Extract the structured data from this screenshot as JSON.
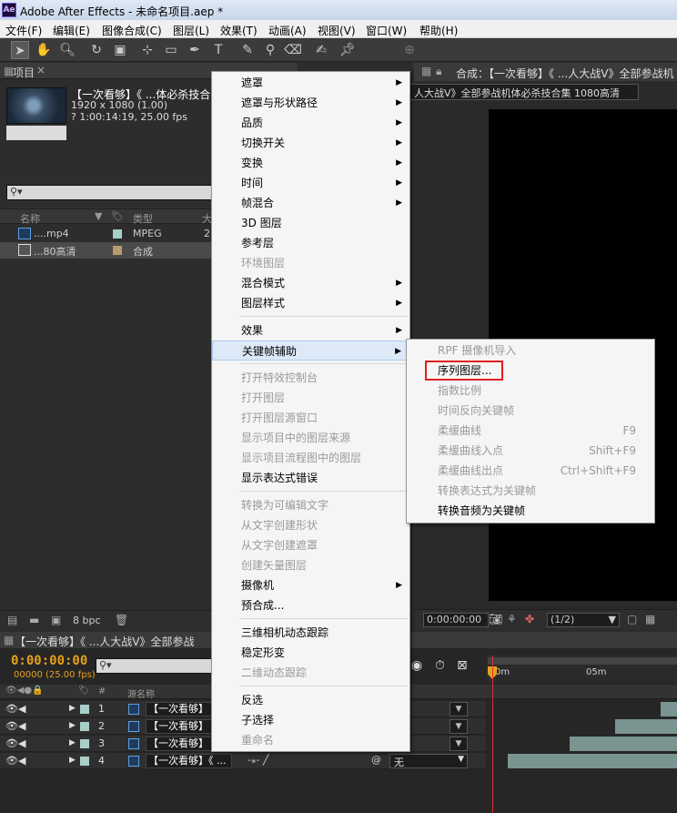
{
  "window": {
    "title": "Adobe After Effects - 未命名项目.aep *",
    "app_icon_text": "Ae"
  },
  "menubar": [
    "文件(F)",
    "编辑(E)",
    "图像合成(C)",
    "图层(L)",
    "效果(T)",
    "动画(A)",
    "视图(V)",
    "窗口(W)",
    "帮助(H)"
  ],
  "project": {
    "tab_label": "项目",
    "selected_name": "【一次看够】《 ...体必杀技合",
    "dimensions": "1920 x 1080 (1.00)",
    "duration": "? 1:00:14:19, 25.00 fps",
    "search_placeholder": "",
    "columns": {
      "name": "名称",
      "type": "类型",
      "size": "大"
    },
    "items": [
      {
        "name": "....mp4",
        "type": "MPEG",
        "extra": "2",
        "color": "#a9cfc9"
      },
      {
        "name": "...80高清",
        "type": "合成",
        "extra": "",
        "color": "#b59b6d"
      }
    ],
    "bpc": "8 bpc"
  },
  "composition": {
    "tab_label": "合成：【一次看够】《 ...人大战V》全部参战机",
    "breadcrumb": "人大战V》全部参战机体必杀技合集 1080高清",
    "timecode": "0:00:00:00",
    "resolution": "(1/2)"
  },
  "timeline": {
    "tab_label": "【一次看够】《 ...人大战V》全部参战",
    "timecode": "0:00:00:00",
    "fps_label": "00000 (25.00 fps)",
    "layer_column": "源名称",
    "num_column": "#",
    "ruler_labels": [
      "0m",
      "05m"
    ],
    "layers": [
      {
        "num": "1",
        "name": "【一次看够】"
      },
      {
        "num": "2",
        "name": "【一次看够】"
      },
      {
        "num": "3",
        "name": "【一次看够】"
      },
      {
        "num": "4",
        "name": "【一次看够】《 ..."
      }
    ],
    "parent_value": "无"
  },
  "context_menu": {
    "items": [
      {
        "label": "遮罩",
        "submenu": true,
        "disabled": false
      },
      {
        "label": "遮罩与形状路径",
        "submenu": true,
        "disabled": false
      },
      {
        "label": "品质",
        "submenu": true,
        "disabled": false
      },
      {
        "label": "切换开关",
        "submenu": true,
        "disabled": false
      },
      {
        "label": "变换",
        "submenu": true,
        "disabled": false
      },
      {
        "label": "时间",
        "submenu": true,
        "disabled": false
      },
      {
        "label": "帧混合",
        "submenu": true,
        "disabled": false
      },
      {
        "label": "3D 图层",
        "submenu": false,
        "disabled": false
      },
      {
        "label": "参考层",
        "submenu": false,
        "disabled": false
      },
      {
        "label": "环境图层",
        "submenu": false,
        "disabled": true
      },
      {
        "label": "混合模式",
        "submenu": true,
        "disabled": false
      },
      {
        "label": "图层样式",
        "submenu": true,
        "disabled": false
      },
      {
        "label": "效果",
        "submenu": true,
        "disabled": false,
        "sep_before": true
      },
      {
        "label": "关键帧辅助",
        "submenu": true,
        "disabled": false,
        "highlighted": true
      },
      {
        "label": "打开特效控制台",
        "submenu": false,
        "disabled": true,
        "sep_before": true
      },
      {
        "label": "打开图层",
        "submenu": false,
        "disabled": true
      },
      {
        "label": "打开图层源窗口",
        "submenu": false,
        "disabled": true
      },
      {
        "label": "显示项目中的图层来源",
        "submenu": false,
        "disabled": true
      },
      {
        "label": "显示项目流程图中的图层",
        "submenu": false,
        "disabled": true
      },
      {
        "label": "显示表达式错误",
        "submenu": false,
        "disabled": false
      },
      {
        "label": "转换为可编辑文字",
        "submenu": false,
        "disabled": true,
        "sep_before": true
      },
      {
        "label": "从文字创建形状",
        "submenu": false,
        "disabled": true
      },
      {
        "label": "从文字创建遮罩",
        "submenu": false,
        "disabled": true
      },
      {
        "label": "创建矢量图层",
        "submenu": false,
        "disabled": true
      },
      {
        "label": "摄像机",
        "submenu": true,
        "disabled": false
      },
      {
        "label": "预合成...",
        "submenu": false,
        "disabled": false
      },
      {
        "label": "三维相机动态跟踪",
        "submenu": false,
        "disabled": false,
        "sep_before": true
      },
      {
        "label": "稳定形变",
        "submenu": false,
        "disabled": false
      },
      {
        "label": "二维动态跟踪",
        "submenu": false,
        "disabled": true
      },
      {
        "label": "反选",
        "submenu": false,
        "disabled": false,
        "sep_before": true
      },
      {
        "label": "子选择",
        "submenu": false,
        "disabled": false
      },
      {
        "label": "重命名",
        "submenu": false,
        "disabled": true
      }
    ]
  },
  "submenu": {
    "items": [
      {
        "label": "RPF 摄像机导入",
        "shortcut": "",
        "disabled": true
      },
      {
        "label": "序列图层...",
        "shortcut": "",
        "disabled": false,
        "boxed": true
      },
      {
        "label": "指数比例",
        "shortcut": "",
        "disabled": true
      },
      {
        "label": "时间反向关键帧",
        "shortcut": "",
        "disabled": true
      },
      {
        "label": "柔缓曲线",
        "shortcut": "F9",
        "disabled": true
      },
      {
        "label": "柔缓曲线入点",
        "shortcut": "Shift+F9",
        "disabled": true
      },
      {
        "label": "柔缓曲线出点",
        "shortcut": "Ctrl+Shift+F9",
        "disabled": true
      },
      {
        "label": "转换表达式为关键帧",
        "shortcut": "",
        "disabled": true
      },
      {
        "label": "转换音频为关键帧",
        "shortcut": "",
        "disabled": false
      }
    ]
  },
  "colors": {
    "highlight_box": "#e02020",
    "timecode": "#e8a01a",
    "playhead": "#e03030"
  }
}
